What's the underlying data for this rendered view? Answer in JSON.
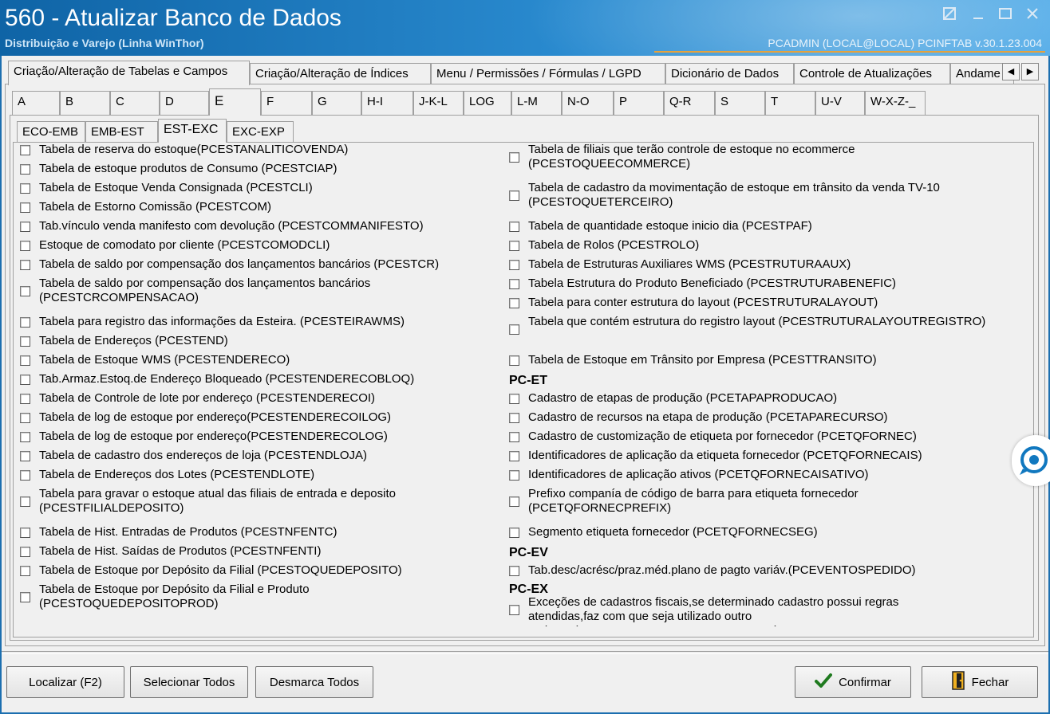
{
  "window": {
    "title": "560 - Atualizar Banco de Dados",
    "subtitle": "Distribuição e Varejo (Linha WinThor)",
    "user_info": "PCADMIN (LOCAL@LOCAL)   PCINFTAB  v.30.1.23.004"
  },
  "main_tabs": [
    {
      "label": "Criação/Alteração de Tabelas e Campos",
      "active": true
    },
    {
      "label": "Criação/Alteração de Índices"
    },
    {
      "label": "Menu / Permissões / Fórmulas / LGPD"
    },
    {
      "label": "Dicionário de Dados"
    },
    {
      "label": "Controle de Atualizações"
    },
    {
      "label": "Andame"
    }
  ],
  "letter_tabs": [
    "A",
    "B",
    "C",
    "D",
    "E",
    "F",
    "G",
    "H-I",
    "J-K-L",
    "LOG",
    "L-M",
    "N-O",
    "P",
    "Q-R",
    "S",
    "T",
    "U-V",
    "W-X-Z-_"
  ],
  "active_letter": "E",
  "sub_tabs": [
    "ECO-EMB",
    "EMB-EST",
    "EST-EXC",
    "EXC-EXP"
  ],
  "active_sub": "EST-EXC",
  "left_items": [
    "Tabela de reserva do estoque(PCESTANALITICOVENDA)",
    "Tabela de estoque produtos de Consumo (PCESTCIAP)",
    "Tabela de Estoque Venda Consignada (PCESTCLI)",
    "Tabela de Estorno Comissão (PCESTCOM)",
    "Tab.vínculo venda manifesto com devolução (PCESTCOMMANIFESTO)",
    "Estoque de comodato por cliente (PCESTCOMODCLI)",
    "Tabela de saldo por compensação dos lançamentos bancários (PCESTCR)",
    "Tabela de saldo por compensação dos lançamentos bancários (PCESTCRCOMPENSACAO)",
    "Tabela para registro das informações da Esteira. (PCESTEIRAWMS)",
    "Tabela de Endereços (PCESTEND)",
    "Tabela de Estoque WMS (PCESTENDERECO)",
    "Tab.Armaz.Estoq.de Endereço Bloqueado (PCESTENDERECOBLOQ)",
    "Tabela de Controle de lote por endereço (PCESTENDERECOI)",
    "Tabela de log de estoque por endereço(PCESTENDERECOILOG)",
    "Tabela de log de estoque por endereço(PCESTENDERECOLOG)",
    "Tabela de cadastro dos endereços de loja (PCESTENDLOJA)",
    "Tabela de Endereços dos Lotes (PCESTENDLOTE)",
    "Tabela para gravar o estoque atual das filiais de entrada e deposito (PCESTFILIALDEPOSITO)",
    "Tabela de Hist. Entradas de Produtos (PCESTNFENTC)",
    "Tabela de Hist. Saídas de Produtos (PCESTNFENTI)",
    "Tabela  de Estoque por Depósito da Filial (PCESTOQUEDEPOSITO)",
    "Tabela  de Estoque por Depósito da Filial e Produto (PCESTOQUEDEPOSITOPROD)"
  ],
  "right_items": [
    "Tabela de filiais que terão controle de estoque no ecommerce (PCESTOQUEECOMMERCE)",
    "Tabela de cadastro da movimentação de estoque em trânsito da venda TV-10 (PCESTOQUETERCEIRO)",
    "Tabela de quantidade estoque inicio dia (PCESTPAF)",
    "Tabela de Rolos (PCESTROLO)",
    "Tabela de Estruturas Auxiliares WMS (PCESTRUTURAAUX)",
    "Tabela Estrutura do Produto Beneficiado (PCESTRUTURABENEFIC)",
    "Tabela para conter estrutura do layout (PCESTRUTURALAYOUT)",
    "Tabela que contém estrutura do registro layout (PCESTRUTURALAYOUTREGISTRO)",
    "Tabela de Estoque em Trânsito por Empresa (PCESTTRANSITO)"
  ],
  "groups": {
    "et": {
      "title": "PC-ET",
      "items": [
        "Cadastro de etapas de produção (PCETAPAPRODUCAO)",
        "Cadastro de recursos na etapa de produção (PCETAPARECURSO)",
        "Cadastro de customização de etiqueta por fornecedor (PCETQFORNEC)",
        "Identificadores de aplicação da etiqueta fornecedor (PCETQFORNECAIS)",
        "Identificadores de aplicação ativos (PCETQFORNECAISATIVO)",
        "Prefixo companía de código de barra para etiqueta fornecedor (PCETQFORNECPREFIX)",
        "Segmento etiqueta fornecedor (PCETQFORNECSEG)"
      ]
    },
    "ev": {
      "title": "PC-EV",
      "items": [
        "Tab.desc/acrésc/praz.méd.plano de pagto variáv.(PCEVENTOSPEDIDO)"
      ]
    },
    "ex": {
      "title": "PC-EX",
      "items": [
        "Exceções de cadastros fiscais,se determinado cadastro possui regras atendidas,faz com que seja utilizado outro cadastro(PCEXCECAOCADASTROSFISCAIS)"
      ]
    }
  },
  "buttons": {
    "localizar": "Localizar (F2)",
    "selecionar_todos": "Selecionar Todos",
    "desmarca_todos": "Desmarca Todos",
    "confirmar": "Confirmar",
    "fechar": "Fechar"
  },
  "icons": {
    "confirm": "checkmark-icon",
    "close": "door-exit-icon",
    "chat": "chat-support-icon"
  }
}
